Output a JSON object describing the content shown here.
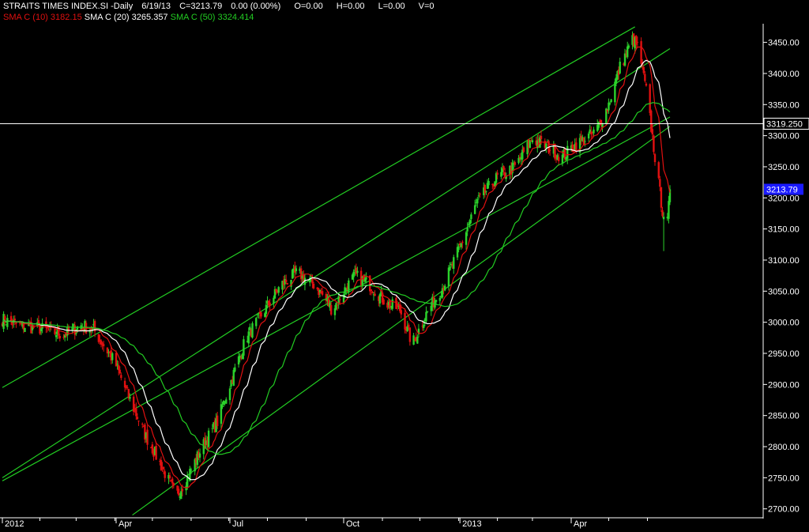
{
  "header": {
    "symbol": "STRAITS TIMES INDEX.SI",
    "period": "-Daily",
    "date": "6/19/13",
    "close": "C=3213.79",
    "change": "0.00 (0.00%)",
    "open": "O=0.00",
    "high": "H=0.00",
    "low": "L=0.00",
    "volume": "V=0"
  },
  "indicators": [
    {
      "label": "SMA C (10)",
      "value": "3182.15",
      "color": "#e01010"
    },
    {
      "label": "SMA C (20)",
      "value": "3265.357",
      "color": "#ffffff"
    },
    {
      "label": "SMA C (50)",
      "value": "3324.414",
      "color": "#22cc22"
    }
  ],
  "chart_data": {
    "type": "candlestick",
    "y_ticks": [
      "3450.00",
      "3400.00",
      "3350.00",
      "3300.00",
      "3250.00",
      "3200.00",
      "3150.00",
      "3100.00",
      "3050.00",
      "3000.00",
      "2950.00",
      "2900.00",
      "2850.00",
      "2800.00",
      "2750.00",
      "2700.00"
    ],
    "ylim": [
      2692,
      3480
    ],
    "x_labels": [
      "2012",
      "Apr",
      "Jul",
      "Oct",
      "2013",
      "Apr"
    ],
    "x_label_dates": [
      "2012-01-02",
      "2012-04-02",
      "2012-07-02",
      "2012-10-01",
      "2013-01-02",
      "2013-04-01"
    ],
    "xlim": [
      "2012-01-02",
      "2013-06-19"
    ],
    "last_close": "3213.79",
    "horizontal_line": "3319.250",
    "price_points": [
      [
        "2012-01-02",
        3005
      ],
      [
        "2012-01-15",
        2995
      ],
      [
        "2012-02-01",
        2990
      ],
      [
        "2012-02-20",
        2980
      ],
      [
        "2012-03-05",
        2995
      ],
      [
        "2012-03-15",
        2988
      ],
      [
        "2012-04-01",
        2935
      ],
      [
        "2012-04-12",
        2880
      ],
      [
        "2012-04-25",
        2820
      ],
      [
        "2012-05-08",
        2770
      ],
      [
        "2012-05-20",
        2720
      ],
      [
        "2012-05-30",
        2755
      ],
      [
        "2012-06-10",
        2800
      ],
      [
        "2012-06-22",
        2840
      ],
      [
        "2012-07-02",
        2900
      ],
      [
        "2012-07-15",
        2975
      ],
      [
        "2012-07-30",
        3020
      ],
      [
        "2012-08-12",
        3060
      ],
      [
        "2012-08-25",
        3080
      ],
      [
        "2012-09-08",
        3060
      ],
      [
        "2012-09-22",
        3020
      ],
      [
        "2012-10-01",
        3050
      ],
      [
        "2012-10-10",
        3075
      ],
      [
        "2012-10-22",
        3060
      ],
      [
        "2012-11-05",
        3030
      ],
      [
        "2012-11-15",
        3020
      ],
      [
        "2012-11-25",
        2965
      ],
      [
        "2012-12-05",
        3010
      ],
      [
        "2012-12-20",
        3060
      ],
      [
        "2013-01-02",
        3120
      ],
      [
        "2013-01-15",
        3190
      ],
      [
        "2013-01-30",
        3230
      ],
      [
        "2013-02-15",
        3250
      ],
      [
        "2013-03-01",
        3295
      ],
      [
        "2013-03-15",
        3280
      ],
      [
        "2013-03-25",
        3265
      ],
      [
        "2013-04-01",
        3280
      ],
      [
        "2013-04-12",
        3295
      ],
      [
        "2013-04-20",
        3305
      ],
      [
        "2013-04-30",
        3345
      ],
      [
        "2013-05-10",
        3410
      ],
      [
        "2013-05-20",
        3455
      ],
      [
        "2013-05-25",
        3440
      ],
      [
        "2013-06-01",
        3360
      ],
      [
        "2013-06-08",
        3250
      ],
      [
        "2013-06-13",
        3180
      ],
      [
        "2013-06-17",
        3160
      ],
      [
        "2013-06-19",
        3213.79
      ]
    ],
    "channel_lines": [
      {
        "from": [
          "2012-01-02",
          2895
        ],
        "to": [
          "2013-05-22",
          3475
        ]
      },
      {
        "from": [
          "2012-01-02",
          2750
        ],
        "to": [
          "2013-06-19",
          3440
        ]
      },
      {
        "from": [
          "2012-01-02",
          2745
        ],
        "to": [
          "2013-06-19",
          3330
        ]
      },
      {
        "from": [
          "2012-04-15",
          2690
        ],
        "to": [
          "2013-06-19",
          3315
        ]
      }
    ],
    "grid": false,
    "legend_position": "top-left"
  },
  "colors": {
    "background": "#000000",
    "up_candle": "#2bd22b",
    "down_candle": "#e01010",
    "channel": "#22cc22",
    "hline": "#ffffff",
    "price_badge": "#1a1aff",
    "axis_text": "#ffffff"
  }
}
